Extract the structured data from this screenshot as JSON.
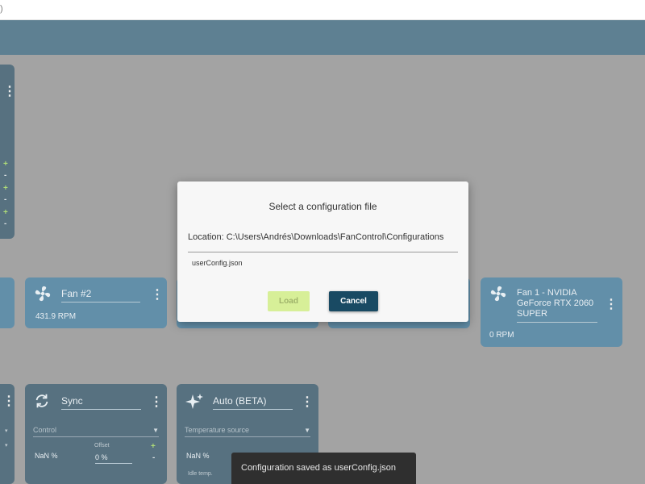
{
  "titlebar": {
    "glyph": ")"
  },
  "cards": {
    "fan2": {
      "title": "Fan #2",
      "speed": "431.9 RPM"
    },
    "fan1": {
      "title": "Fan 1 - NVIDIA GeForce RTX 2060 SUPER",
      "speed": "0 RPM"
    },
    "sync": {
      "title": "Sync",
      "control_placeholder": "Control",
      "value": "NaN %",
      "offset_label": "Offset",
      "offset_value": "0 %"
    },
    "auto": {
      "title": "Auto (BETA)",
      "source_placeholder": "Temperature source",
      "value": "NaN %",
      "idle_label": "Idle temp."
    }
  },
  "dialog": {
    "title": "Select a configuration file",
    "location": "Location: C:\\Users\\Andrés\\Downloads\\FanControl\\Configurations",
    "file": "userConfig.json",
    "load_label": "Load",
    "cancel_label": "Cancel"
  },
  "snackbar": {
    "message": "Configuration saved as userConfig.json"
  },
  "colors": {
    "appbar": "#194a63",
    "card_blue": "#1f5f84",
    "card_dark": "#0f3449",
    "accent_green": "#8ecf3e",
    "load_disabled": "#d7ef98"
  }
}
